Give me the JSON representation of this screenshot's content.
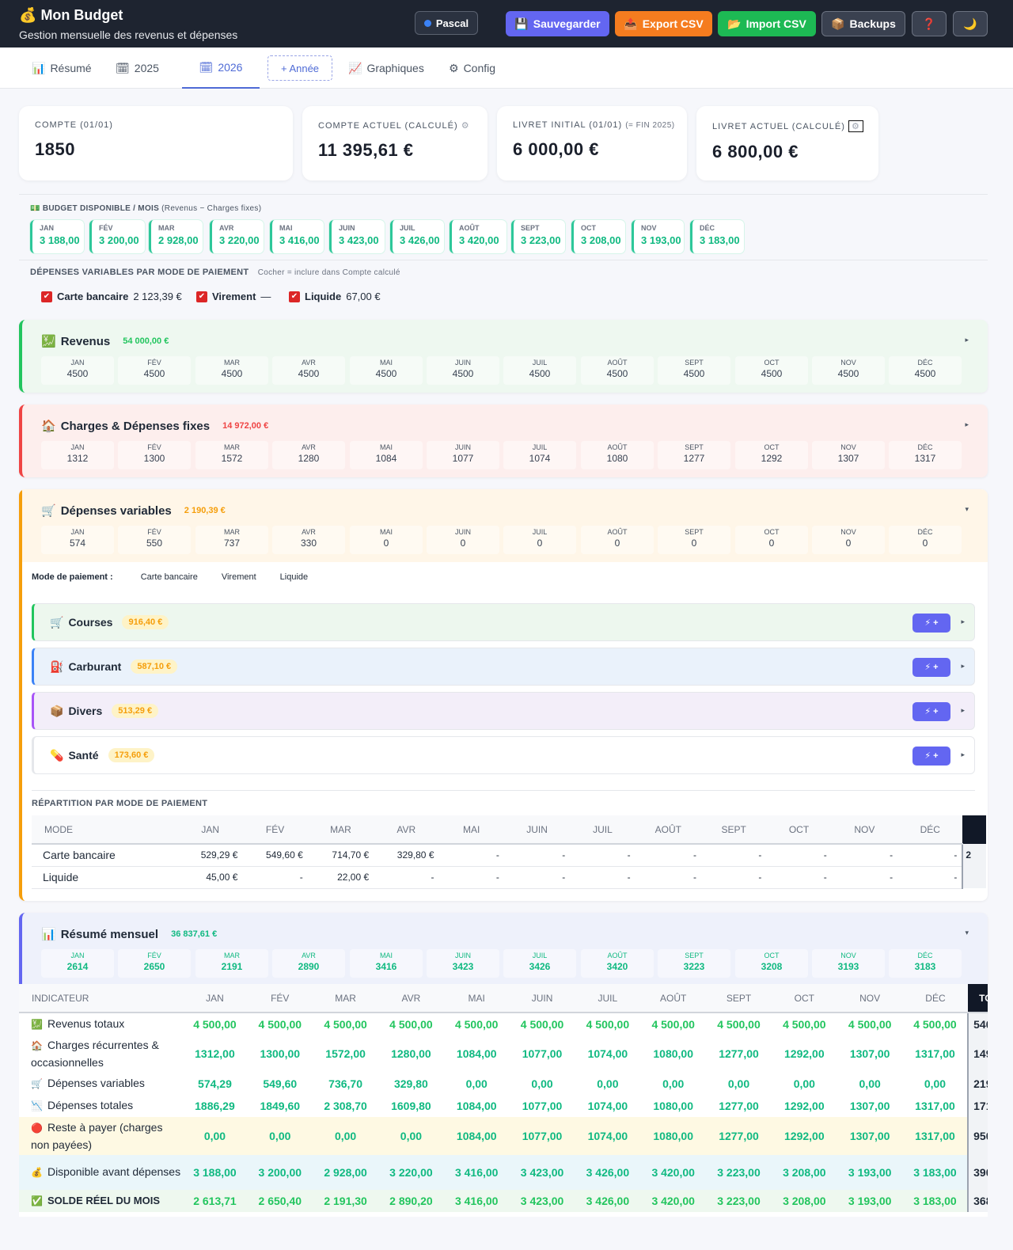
{
  "header": {
    "title": "Mon Budget",
    "subtitle": "Gestion mensuelle des revenus et dépenses",
    "user": "Pascal",
    "buttons": {
      "save": "Sauvegarder",
      "export": "Export CSV",
      "import": "Import CSV",
      "backups": "Backups",
      "help": "❓",
      "theme": "🌙"
    }
  },
  "tabs": {
    "resume": "Résumé",
    "y2025": "2025",
    "y2026": "2026",
    "add_year": "+ Année",
    "charts": "Graphiques",
    "config": "Config"
  },
  "cards": {
    "compte": {
      "label": "COMPTE (01/01)",
      "value": "1850"
    },
    "compte_actuel": {
      "label": "COMPTE ACTUEL (CALCULÉ)",
      "value": "11 395,61 €"
    },
    "livret_initial": {
      "label": "LIVRET INITIAL (01/01)",
      "note": "(= FIN 2025)",
      "value": "6 000,00 €"
    },
    "livret_actuel": {
      "label": "LIVRET ACTUEL (CALCULÉ)",
      "value": "6 800,00 €"
    }
  },
  "budget": {
    "title": "BUDGET DISPONIBLE / MOIS",
    "note": "(Revenus − Charges fixes)",
    "months": [
      {
        "m": "JAN",
        "v": "3 188,00"
      },
      {
        "m": "FÉV",
        "v": "3 200,00"
      },
      {
        "m": "MAR",
        "v": "2 928,00"
      },
      {
        "m": "AVR",
        "v": "3 220,00"
      },
      {
        "m": "MAI",
        "v": "3 416,00"
      },
      {
        "m": "JUIN",
        "v": "3 423,00"
      },
      {
        "m": "JUIL",
        "v": "3 426,00"
      },
      {
        "m": "AOÛT",
        "v": "3 420,00"
      },
      {
        "m": "SEPT",
        "v": "3 223,00"
      },
      {
        "m": "OCT",
        "v": "3 208,00"
      },
      {
        "m": "NOV",
        "v": "3 193,00"
      },
      {
        "m": "DÉC",
        "v": "3 183,00"
      }
    ]
  },
  "depmode": {
    "title": "DÉPENSES VARIABLES PAR MODE DE PAIEMENT",
    "hint": "Cocher = inclure dans Compte calculé",
    "items": [
      {
        "label": "Carte bancaire",
        "amount": "2 123,39 €"
      },
      {
        "label": "Virement",
        "amount": "—"
      },
      {
        "label": "Liquide",
        "amount": "67,00 €"
      }
    ]
  },
  "months_short": [
    "JAN",
    "FÉV",
    "MAR",
    "AVR",
    "MAI",
    "JUIN",
    "JUIL",
    "AOÛT",
    "SEPT",
    "OCT",
    "NOV",
    "DÉC"
  ],
  "revenus": {
    "title": "Revenus",
    "total": "54 000,00 €",
    "values": [
      "4500",
      "4500",
      "4500",
      "4500",
      "4500",
      "4500",
      "4500",
      "4500",
      "4500",
      "4500",
      "4500",
      "4500"
    ]
  },
  "charges": {
    "title": "Charges & Dépenses fixes",
    "total": "14 972,00 €",
    "values": [
      "1312",
      "1300",
      "1572",
      "1280",
      "1084",
      "1077",
      "1074",
      "1080",
      "1277",
      "1292",
      "1307",
      "1317"
    ]
  },
  "variables": {
    "title": "Dépenses variables",
    "total": "2 190,39 €",
    "values": [
      "574",
      "550",
      "737",
      "330",
      "0",
      "0",
      "0",
      "0",
      "0",
      "0",
      "0",
      "0"
    ],
    "mode_label": "Mode de paiement :",
    "modes": [
      "Carte bancaire",
      "Virement",
      "Liquide"
    ],
    "categories": [
      {
        "name": "Courses",
        "amount": "916,40 €",
        "icon": "🛒",
        "bg": "#edf7ee",
        "border": "#22c55e"
      },
      {
        "name": "Carburant",
        "amount": "587,10 €",
        "icon": "⛽",
        "bg": "#eaf2fb",
        "border": "#3b82f6"
      },
      {
        "name": "Divers",
        "amount": "513,29 €",
        "icon": "📦",
        "bg": "#f3eef9",
        "border": "#a855f7"
      },
      {
        "name": "Santé",
        "amount": "173,60 €",
        "icon": "💊",
        "bg": "#ffffff",
        "border": "#e5e7eb"
      }
    ],
    "quick_add": "⚡ +"
  },
  "repartition": {
    "title": "RÉPARTITION PAR MODE DE PAIEMENT",
    "header": [
      "MODE",
      "JAN",
      "FÉV",
      "MAR",
      "AVR",
      "MAI",
      "JUIN",
      "JUIL",
      "AOÛT",
      "SEPT",
      "OCT",
      "NOV",
      "DÉC"
    ],
    "total_cells": [
      "2",
      ""
    ],
    "rows": [
      {
        "mode": "Carte bancaire",
        "cells": [
          "529,29 €",
          "549,60 €",
          "714,70 €",
          "329,80 €",
          "-",
          "-",
          "-",
          "-",
          "-",
          "-",
          "-",
          "-"
        ]
      },
      {
        "mode": "Liquide",
        "cells": [
          "45,00 €",
          "-",
          "22,00 €",
          "-",
          "-",
          "-",
          "-",
          "-",
          "-",
          "-",
          "-",
          "-"
        ]
      }
    ]
  },
  "resume": {
    "title": "Résumé mensuel",
    "total": "36 837,61 €",
    "values": [
      "2614",
      "2650",
      "2191",
      "2890",
      "3416",
      "3423",
      "3426",
      "3420",
      "3223",
      "3208",
      "3193",
      "3183"
    ],
    "header": [
      "INDICATEUR",
      "JAN",
      "FÉV",
      "MAR",
      "AVR",
      "MAI",
      "JUIN",
      "JUIL",
      "AOÛT",
      "SEPT",
      "OCT",
      "NOV",
      "DÉC",
      "TO"
    ],
    "rows": [
      {
        "label": "Revenus totaux",
        "icon": "💹",
        "total": "540",
        "color": "#22c55e",
        "bg": "#ffffff",
        "cells": [
          "4 500,00",
          "4 500,00",
          "4 500,00",
          "4 500,00",
          "4 500,00",
          "4 500,00",
          "4 500,00",
          "4 500,00",
          "4 500,00",
          "4 500,00",
          "4 500,00",
          "4 500,00"
        ]
      },
      {
        "label": "Charges récurrentes & occasionnelles",
        "icon": "🏠",
        "total": "149",
        "color": "#10b981",
        "bg": "#ffffff",
        "cells": [
          "1312,00",
          "1300,00",
          "1572,00",
          "1280,00",
          "1084,00",
          "1077,00",
          "1074,00",
          "1080,00",
          "1277,00",
          "1292,00",
          "1307,00",
          "1317,00"
        ]
      },
      {
        "label": "Dépenses variables",
        "icon": "🛒",
        "total": "219",
        "color": "#10b981",
        "bg": "#ffffff",
        "cells": [
          "574,29",
          "549,60",
          "736,70",
          "329,80",
          "0,00",
          "0,00",
          "0,00",
          "0,00",
          "0,00",
          "0,00",
          "0,00",
          "0,00"
        ]
      },
      {
        "label": "Dépenses totales",
        "icon": "📉",
        "total": "171",
        "color": "#10b981",
        "bg": "#ffffff",
        "cells": [
          "1886,29",
          "1849,60",
          "2 308,70",
          "1609,80",
          "1084,00",
          "1077,00",
          "1074,00",
          "1080,00",
          "1277,00",
          "1292,00",
          "1307,00",
          "1317,00"
        ]
      },
      {
        "label": "Reste à payer (charges non payées)",
        "icon": "🔴",
        "total": "950",
        "color": "#10b981",
        "bg": "#fef9e3",
        "cells": [
          "0,00",
          "0,00",
          "0,00",
          "0,00",
          "1084,00",
          "1077,00",
          "1074,00",
          "1080,00",
          "1277,00",
          "1292,00",
          "1307,00",
          "1317,00"
        ]
      },
      {
        "label": "Disponible avant dépenses",
        "icon": "💰",
        "total": "390",
        "color": "#10b981",
        "bg": "#eaf6fa",
        "cells": [
          "3 188,00",
          "3 200,00",
          "2 928,00",
          "3 220,00",
          "3 416,00",
          "3 423,00",
          "3 426,00",
          "3 420,00",
          "3 223,00",
          "3 208,00",
          "3 193,00",
          "3 183,00"
        ]
      },
      {
        "label": "SOLDE RÉEL DU MOIS",
        "icon": "✅",
        "total": "368",
        "color": "#22c55e",
        "bg": "#eef8ef",
        "cells": [
          "2 613,71",
          "2 650,40",
          "2 191,30",
          "2 890,20",
          "3 416,00",
          "3 423,00",
          "3 426,00",
          "3 420,00",
          "3 223,00",
          "3 208,00",
          "3 193,00",
          "3 183,00"
        ]
      }
    ]
  }
}
